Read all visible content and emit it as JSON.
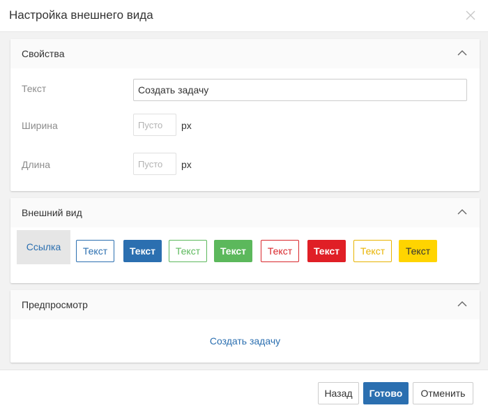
{
  "dialog": {
    "title": "Настройка внешнего вида"
  },
  "properties": {
    "title": "Свойства",
    "text_label": "Текст",
    "text_value": "Создать задачу",
    "width_label": "Ширина",
    "width_placeholder": "Пусто",
    "width_unit": "px",
    "length_label": "Длина",
    "length_placeholder": "Пусто",
    "length_unit": "px"
  },
  "appearance": {
    "title": "Внешний вид",
    "styles": [
      {
        "label": "Ссылка",
        "variant": "link"
      },
      {
        "label": "Текст",
        "variant": "outline",
        "color": "#2b6fb0"
      },
      {
        "label": "Текст",
        "variant": "filled",
        "color": "#2b6fb0"
      },
      {
        "label": "Текст",
        "variant": "outline",
        "color": "#5cb85c"
      },
      {
        "label": "Текст",
        "variant": "filled",
        "color": "#5cb85c"
      },
      {
        "label": "Текст",
        "variant": "outline",
        "color": "#d9262b"
      },
      {
        "label": "Текст",
        "variant": "filled",
        "color": "#e01f26"
      },
      {
        "label": "Текст",
        "variant": "outline",
        "color": "#e8b300"
      },
      {
        "label": "Текст",
        "variant": "filled",
        "color": "#ffd400"
      }
    ]
  },
  "preview": {
    "title": "Предпросмотр",
    "link_text": "Создать задачу"
  },
  "footer": {
    "back_label": "Назад",
    "done_label": "Готово",
    "cancel_label": "Отменить"
  },
  "colors": {
    "accent": "#2b6fb0",
    "body_bg": "#f2f2f2"
  }
}
